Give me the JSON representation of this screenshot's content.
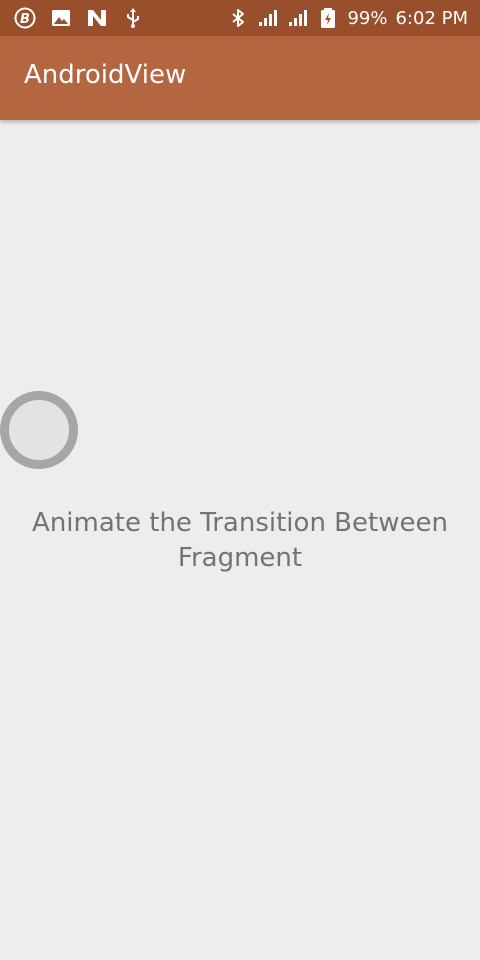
{
  "status_bar": {
    "icons_left": [
      "b-app-icon",
      "image-icon",
      "n-app-icon",
      "usb-icon"
    ],
    "icons_right": [
      "bluetooth-icon",
      "signal-icon",
      "signal-icon",
      "battery-charging-icon"
    ],
    "battery": "99%",
    "time": "6:02 PM"
  },
  "app_bar": {
    "title": "AndroidView"
  },
  "content": {
    "caption": "Animate the Transition Between Fragment"
  },
  "colors": {
    "status_bar": "#9a4f2c",
    "app_bar": "#b3663f",
    "background": "#ededed",
    "circle_ring": "#a6a6a6",
    "circle_fill": "#e3e3e3",
    "caption_text": "#737373"
  }
}
